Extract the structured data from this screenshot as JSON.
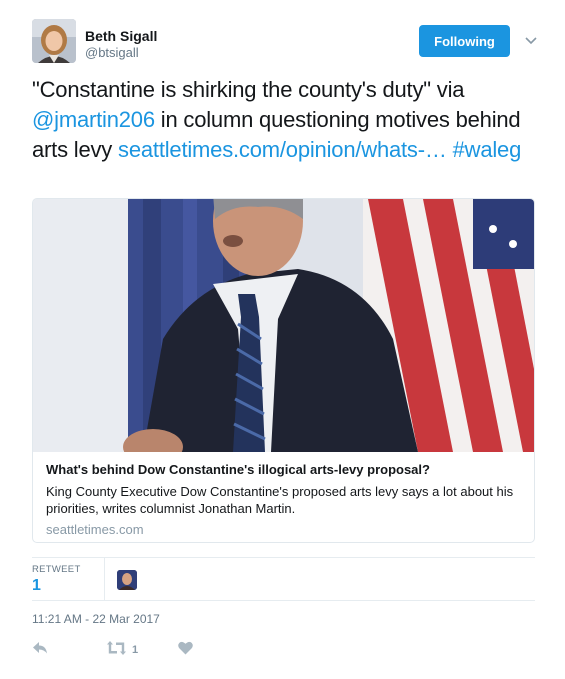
{
  "user": {
    "display_name": "Beth Sigall",
    "handle": "@btsigall"
  },
  "follow_button": {
    "label": "Following",
    "color": "#1b95e0"
  },
  "tweet": {
    "text_before": "\"Constantine is shirking the county's duty\" via ",
    "mention": "@jmartin206",
    "text_middle": " in column questioning motives behind arts levy ",
    "link": "seattletimes.com/opinion/whats-…",
    "text_space": " ",
    "hashtag": "#waleg"
  },
  "card": {
    "title": "What's behind Dow Constantine's illogical arts-levy proposal?",
    "description": "King County Executive Dow Constantine's proposed arts levy says a lot about his priorities, writes columnist Jonathan Martin.",
    "domain": "seattletimes.com"
  },
  "stats": {
    "retweet_label": "RETWEET",
    "retweet_count": "1"
  },
  "timestamp": "11:21 AM - 22 Mar 2017",
  "actions": {
    "reply_icon": "reply-icon",
    "retweet_icon": "retweet-icon",
    "retweet_count": "1",
    "like_icon": "heart-icon"
  },
  "colors": {
    "link": "#1b95e0",
    "muted": "#657786",
    "border": "#e1e8ed"
  }
}
